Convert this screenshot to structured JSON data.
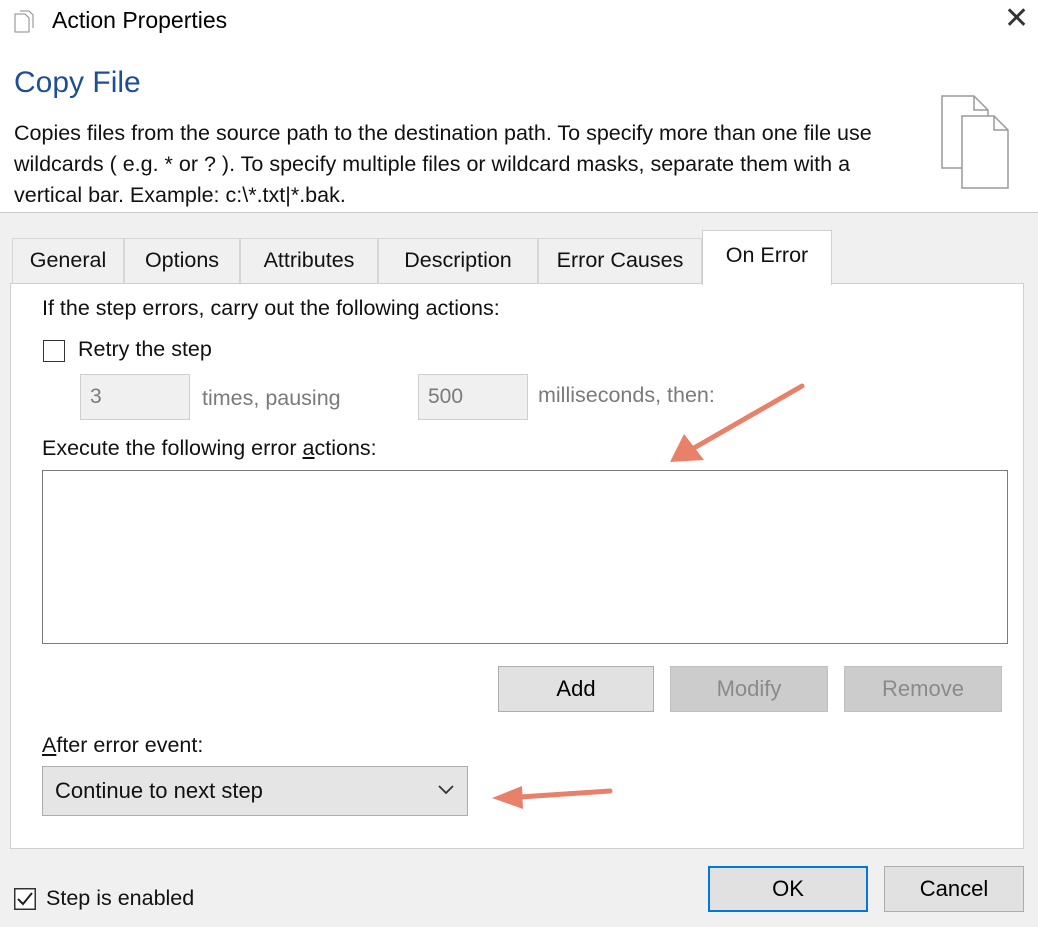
{
  "window": {
    "title": "Action Properties"
  },
  "header": {
    "action_name": "Copy File",
    "description": "Copies files from the source path to the destination path.  To specify more than one file use wildcards ( e.g. * or ? ).  To specify multiple files or wildcard masks, separate them with a vertical bar.  Example: c:\\*.txt|*.bak."
  },
  "tabs": [
    {
      "label": "General"
    },
    {
      "label": "Options"
    },
    {
      "label": "Attributes"
    },
    {
      "label": "Description"
    },
    {
      "label": "Error Causes"
    },
    {
      "label": "On Error",
      "active": true
    }
  ],
  "on_error": {
    "intro": "If the step errors, carry out the following actions:",
    "retry_label": "Retry the step",
    "retry_checked": false,
    "retry_times": "3",
    "times_label": "times, pausing",
    "pause_ms": "500",
    "ms_label": "milliseconds, then:",
    "error_actions_label_pre": "Execute the following error ",
    "error_actions_label_underlined": "a",
    "error_actions_label_post": "ctions:",
    "add_label": "Add",
    "modify_label": "Modify",
    "remove_label": "Remove",
    "after_label_underlined": "A",
    "after_label_rest": "fter error event:",
    "after_value": "Continue to next step"
  },
  "footer": {
    "enabled_label": "Step is enabled",
    "enabled_checked": true,
    "ok_label": "OK",
    "cancel_label": "Cancel"
  },
  "colors": {
    "accent": "#0078d7",
    "title_blue": "#1f4e98",
    "arrow": "#e8806a"
  }
}
